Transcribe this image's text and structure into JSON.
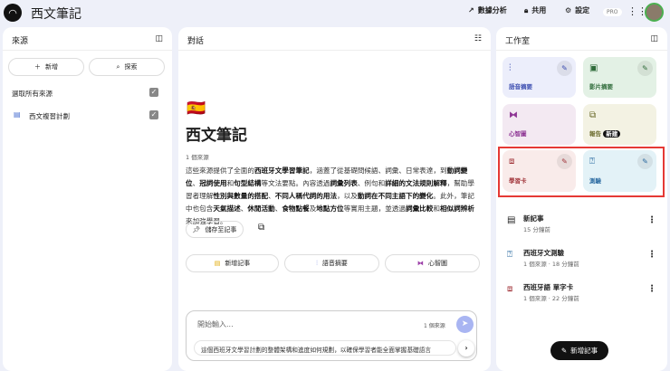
{
  "header": {
    "title": "西文筆記",
    "analytics": "數據分析",
    "share": "共用",
    "settings": "設定",
    "pro": "PRO"
  },
  "sources": {
    "title": "來源",
    "add": "新增",
    "explore": "探索",
    "select_all": "選取所有來源",
    "items": [
      {
        "label": "西文複習計劃"
      }
    ]
  },
  "chat": {
    "title": "對話",
    "flag": "🇪🇸",
    "notebook_title": "西文筆記",
    "source_count": "1 個來源",
    "summary_parts": [
      "這些來源提供了全面的",
      "西班牙文學習筆記",
      "，涵蓋了從基礎問候語、詞彙、日常表達，到",
      "動詞變位",
      "、",
      "冠詞使用",
      "和",
      "句型結構",
      "等文法要點。內容透過",
      "詞彙列表",
      "、例句和",
      "詳細的文法規則解釋",
      "，幫助學習者理解",
      "性別與數量的搭配",
      "、",
      "不同人稱代詞的用法",
      "，以及",
      "動詞在不同主語下的變化",
      "。此外，筆記中也包含",
      "天氣描述",
      "、",
      "休閒活動",
      "、",
      "食物點餐",
      "及",
      "地點方位",
      "等實用主題，並透過",
      "詞彙比較",
      "和",
      "相似詞辨析",
      "來加強學習。"
    ],
    "save_note": "儲存至記事",
    "chips": [
      "新增記事",
      "語音摘要",
      "心智圖"
    ],
    "input_placeholder": "開始輸入...",
    "input_sources": "1 個來源",
    "suggestion": "這個西班牙文學習計劃的整體架構和進度如何規劃，以確保學習者能全面掌握基礎語言"
  },
  "studio": {
    "title": "工作室",
    "cards": [
      "語音摘要",
      "影片摘要",
      "心智圖",
      "報告",
      "學習卡",
      "測驗"
    ],
    "new_badge": "新建",
    "notes": [
      {
        "title": "新記事",
        "meta": "15 分鐘前"
      },
      {
        "title": "西班牙文測驗",
        "meta": "1 個來源 · 18 分鐘前"
      },
      {
        "title": "西班牙語 單字卡",
        "meta": "1 個來源 · 22 分鐘前"
      }
    ],
    "add_note": "新增記事"
  },
  "colors": {
    "highlight": "#e53935"
  }
}
